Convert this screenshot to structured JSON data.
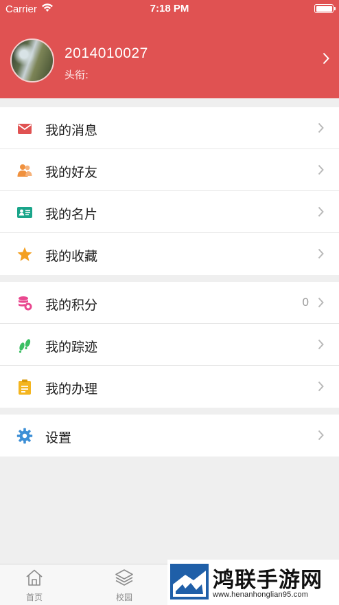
{
  "status_bar": {
    "carrier": "Carrier",
    "time": "7:18 PM"
  },
  "profile": {
    "name": "2014010027",
    "title_label": "头衔:"
  },
  "menu_groups": [
    {
      "items": [
        {
          "label": "我的消息",
          "icon": "mail-icon",
          "color": "#e05252"
        },
        {
          "label": "我的好友",
          "icon": "friends-icon",
          "color": "#f0913e"
        },
        {
          "label": "我的名片",
          "icon": "card-icon",
          "color": "#1aa58a"
        },
        {
          "label": "我的收藏",
          "icon": "star-icon",
          "color": "#f4a020"
        }
      ]
    },
    {
      "items": [
        {
          "label": "我的积分",
          "icon": "points-icon",
          "color": "#e9488f",
          "value": "0"
        },
        {
          "label": "我的踪迹",
          "icon": "footprint-icon",
          "color": "#3cbf63"
        },
        {
          "label": "我的办理",
          "icon": "clipboard-icon",
          "color": "#f4b51f"
        }
      ]
    },
    {
      "items": [
        {
          "label": "设置",
          "icon": "gear-icon",
          "color": "#3d8fd6"
        }
      ]
    }
  ],
  "tabbar": {
    "tabs": [
      {
        "label": "首页",
        "icon": "home-icon"
      },
      {
        "label": "校园",
        "icon": "layers-icon"
      }
    ]
  },
  "watermark": {
    "text": "鸿联手游网",
    "url": "www.henanhonglian95.com"
  }
}
